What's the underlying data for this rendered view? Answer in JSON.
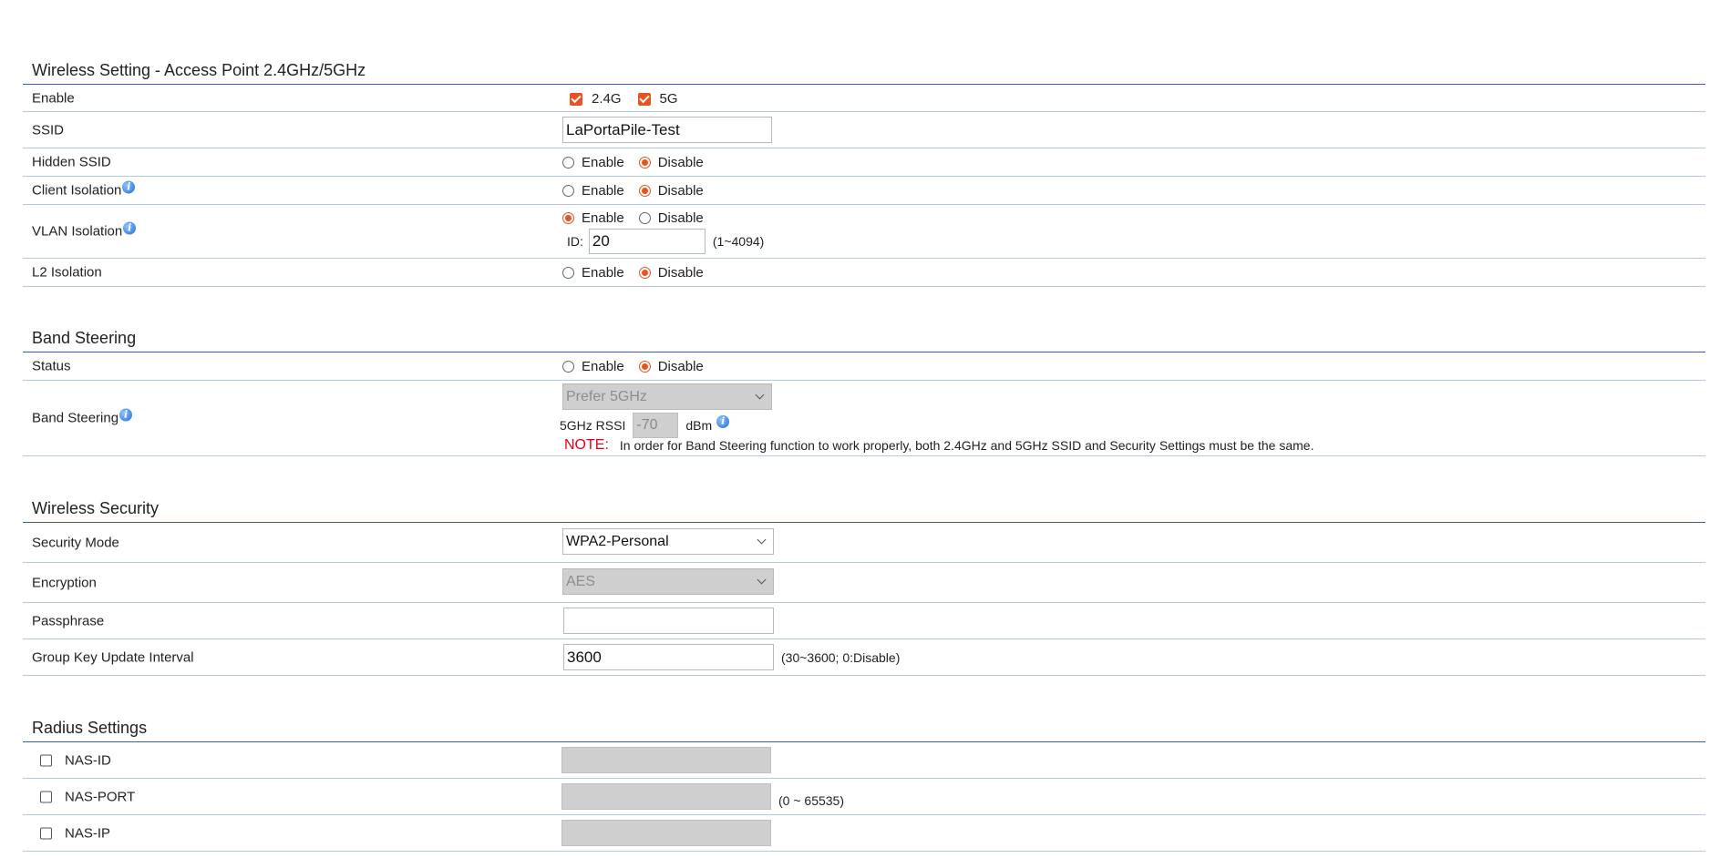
{
  "wireless_setting": {
    "title": "Wireless Setting - Access Point 2.4GHz/5GHz",
    "enable": {
      "label": "Enable",
      "band_24": "2.4G",
      "band_5": "5G",
      "checked_24": true,
      "checked_5": true
    },
    "ssid": {
      "label": "SSID",
      "value": "LaPortaPile-Test"
    },
    "hidden_ssid": {
      "label": "Hidden SSID",
      "enable": "Enable",
      "disable": "Disable",
      "selected": "Disable"
    },
    "client_isolation": {
      "label": "Client Isolation",
      "enable": "Enable",
      "disable": "Disable",
      "selected": "Disable"
    },
    "vlan_isolation": {
      "label": "VLAN Isolation",
      "enable": "Enable",
      "disable": "Disable",
      "selected": "Enable",
      "id_label": "ID:",
      "id_value": "20",
      "range": "(1~4094)"
    },
    "l2_isolation": {
      "label": "L2 Isolation",
      "enable": "Enable",
      "disable": "Disable",
      "selected": "Disable"
    }
  },
  "band_steering": {
    "title": "Band Steering",
    "status": {
      "label": "Status",
      "enable": "Enable",
      "disable": "Disable",
      "selected": "Disable"
    },
    "steering": {
      "label": "Band Steering",
      "mode": "Prefer 5GHz",
      "rssi_label": "5GHz RSSI",
      "rssi_value": "-70",
      "rssi_unit": "dBm"
    },
    "note_label": "NOTE:",
    "note_text": "In order for Band Steering function to work properly, both 2.4GHz and 5GHz SSID and Security Settings must be the same."
  },
  "wireless_security": {
    "title": "Wireless Security",
    "security_mode": {
      "label": "Security Mode",
      "value": "WPA2-Personal"
    },
    "encryption": {
      "label": "Encryption",
      "value": "AES"
    },
    "passphrase": {
      "label": "Passphrase",
      "value": ""
    },
    "group_key": {
      "label": "Group Key Update Interval",
      "value": "3600",
      "range": "(30~3600; 0:Disable)"
    }
  },
  "radius_settings": {
    "title": "Radius Settings",
    "nas_id": {
      "label": "NAS-ID",
      "value": ""
    },
    "nas_port": {
      "label": "NAS-PORT",
      "value": "",
      "range": "(0 ~ 65535)"
    },
    "nas_ip": {
      "label": "NAS-IP",
      "value": ""
    }
  },
  "colors": {
    "accent": "#e8531f",
    "rule": "#3b5ea8",
    "row_border": "#b7c7dd",
    "note": "#e8001b"
  }
}
